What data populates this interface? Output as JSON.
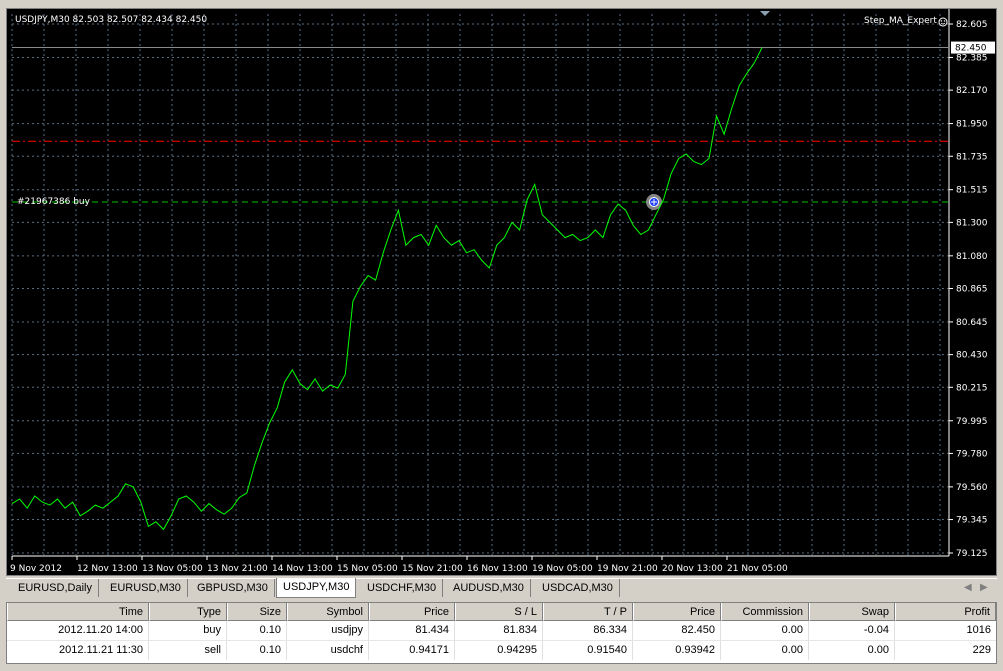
{
  "chart": {
    "title": "USDJPY,M30  82.503 82.507 82.434 82.450",
    "expert_label": "Step_MA_Expert",
    "order_label": "#21967386 buy",
    "current_price": "82.450",
    "price_ticks": [
      "82.605",
      "82.385",
      "82.170",
      "81.950",
      "81.735",
      "81.515",
      "81.300",
      "81.080",
      "80.865",
      "80.645",
      "80.430",
      "80.215",
      "79.995",
      "79.780",
      "79.560",
      "79.345",
      "79.125"
    ],
    "time_ticks": [
      "9 Nov 2012",
      "12 Nov 13:00",
      "13 Nov 05:00",
      "13 Nov 21:00",
      "14 Nov 13:00",
      "15 Nov 05:00",
      "15 Nov 21:00",
      "16 Nov 13:00",
      "19 Nov 05:00",
      "19 Nov 21:00",
      "20 Nov 13:00",
      "21 Nov 05:00"
    ],
    "colors": {
      "background": "#000000",
      "grid": "#5a6e82",
      "price_line": "#00ff00",
      "take_profit_line": "#ff0000",
      "order_line": "#00c000",
      "text": "#ffffff"
    },
    "icons": {
      "expert": "smiley-icon",
      "order": "crosshair-marker-icon"
    }
  },
  "chart_data": {
    "type": "line",
    "symbol": "USDJPY",
    "timeframe": "M30",
    "ylim": [
      79.125,
      82.605
    ],
    "take_profit_level": 81.834,
    "order_price": 81.434,
    "current_price": 82.45,
    "x_tick_labels": [
      "9 Nov 2012",
      "12 Nov 13:00",
      "13 Nov 05:00",
      "13 Nov 21:00",
      "14 Nov 13:00",
      "15 Nov 05:00",
      "15 Nov 21:00",
      "16 Nov 13:00",
      "19 Nov 05:00",
      "19 Nov 21:00",
      "20 Nov 13:00",
      "21 Nov 05:00"
    ],
    "series": [
      {
        "values": [
          79.45,
          79.48,
          79.42,
          79.5,
          79.46,
          79.44,
          79.48,
          79.42,
          79.46,
          79.37,
          79.4,
          79.44,
          79.42,
          79.46,
          79.5,
          79.58,
          79.56,
          79.46,
          79.3,
          79.33,
          79.28,
          79.37,
          79.48,
          79.5,
          79.46,
          79.4,
          79.45,
          79.41,
          79.38,
          79.42,
          79.49,
          79.52,
          79.7,
          79.85,
          79.98,
          80.08,
          80.25,
          80.33,
          80.24,
          80.2,
          80.27,
          80.19,
          80.23,
          80.21,
          80.3,
          80.78,
          80.88,
          80.95,
          80.92,
          81.1,
          81.25,
          81.38,
          81.15,
          81.2,
          81.22,
          81.15,
          81.28,
          81.2,
          81.15,
          81.18,
          81.1,
          81.12,
          81.05,
          81.0,
          81.15,
          81.2,
          81.3,
          81.25,
          81.45,
          81.55,
          81.35,
          81.3,
          81.25,
          81.2,
          81.22,
          81.18,
          81.2,
          81.25,
          81.2,
          81.35,
          81.42,
          81.38,
          81.28,
          81.22,
          81.25,
          81.35,
          81.45,
          81.62,
          81.72,
          81.75,
          81.7,
          81.68,
          81.72,
          82.0,
          81.88,
          82.05,
          82.2,
          82.28,
          82.35,
          82.45
        ]
      }
    ]
  },
  "tabs": [
    {
      "label": "EURUSD,Daily"
    },
    {
      "label": "EURUSD,M30"
    },
    {
      "label": "GBPUSD,M30"
    },
    {
      "label": "USDJPY,M30"
    },
    {
      "label": "USDCHF,M30"
    },
    {
      "label": "AUDUSD,M30"
    },
    {
      "label": "USDCAD,M30"
    }
  ],
  "active_tab": "USDJPY,M30",
  "table": {
    "columns": [
      "Time",
      "Type",
      "Size",
      "Symbol",
      "Price",
      "S / L",
      "T / P",
      "Price",
      "Commission",
      "Swap",
      "Profit"
    ],
    "rows": [
      [
        "2012.11.20 14:00",
        "buy",
        "0.10",
        "usdjpy",
        "81.434",
        "81.834",
        "86.334",
        "82.450",
        "0.00",
        "-0.04",
        "1016"
      ],
      [
        "2012.11.21 11:30",
        "sell",
        "0.10",
        "usdchf",
        "0.94171",
        "0.94295",
        "0.91540",
        "0.93942",
        "0.00",
        "0.00",
        "229"
      ]
    ]
  }
}
